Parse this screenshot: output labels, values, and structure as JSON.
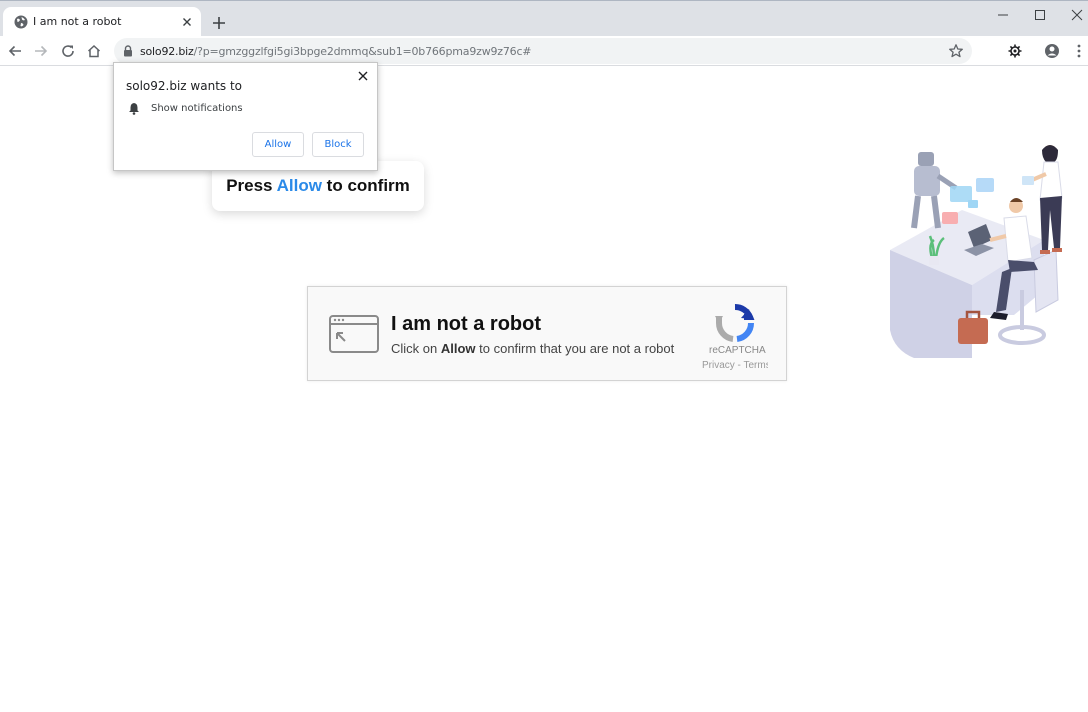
{
  "browser": {
    "tab": {
      "title": "I am not a robot",
      "favicon": "globe-icon"
    },
    "url": {
      "host": "solo92.biz",
      "path": "/?p=gmzggzlfgi5gi3bpge2dmmq&sub1=0b766pma9zw9z76c#"
    }
  },
  "notification": {
    "title": "solo92.biz wants to",
    "permission": "Show notifications",
    "allow_label": "Allow",
    "block_label": "Block"
  },
  "press": {
    "before": "Press ",
    "highlight": "Allow",
    "after": " to confirm"
  },
  "captcha": {
    "title": "I am not a robot",
    "sub_before": "Click on ",
    "sub_bold": "Allow",
    "sub_after": " to confirm that you are not a robot",
    "brand": "reCAPTCHA",
    "links": "Privacy - Terms"
  },
  "colors": {
    "accent": "#2b8ae8",
    "button_text": "#1a73e8",
    "tabstrip": "#dee1e6"
  }
}
